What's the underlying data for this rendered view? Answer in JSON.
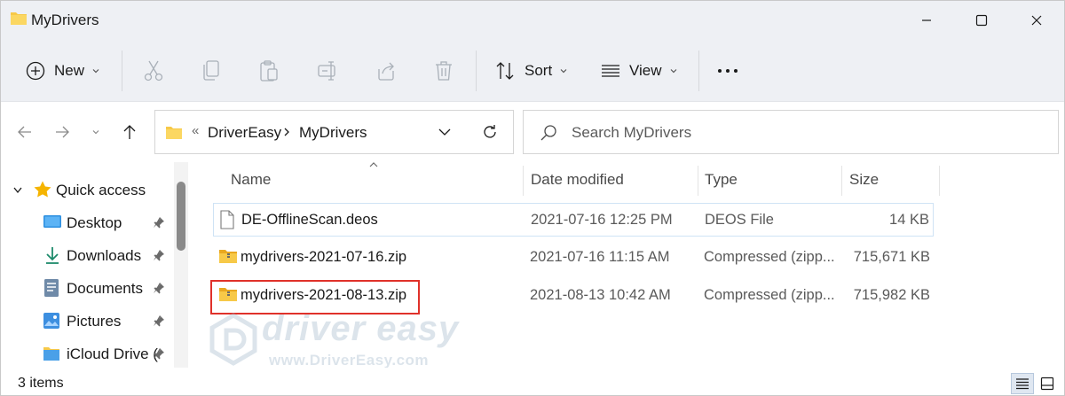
{
  "window": {
    "title": "MyDrivers",
    "controls": {
      "minimize_icon": "minimize-icon",
      "maximize_icon": "maximize-icon",
      "close_icon": "close-icon"
    }
  },
  "commandbar": {
    "new_label": "New",
    "sort_label": "Sort",
    "view_label": "View",
    "icons": [
      "cut-icon",
      "copy-icon",
      "paste-icon",
      "rename-icon",
      "share-icon",
      "delete-icon",
      "more-icon"
    ]
  },
  "addressbar": {
    "breadcrumb": [
      "DriverEasy",
      "MyDrivers"
    ],
    "overflow": "«"
  },
  "search": {
    "placeholder": "Search MyDrivers"
  },
  "navpane": {
    "items": [
      {
        "label": "Quick access",
        "icon": "star-icon"
      },
      {
        "label": "Desktop",
        "icon": "desktop-icon"
      },
      {
        "label": "Downloads",
        "icon": "download-icon"
      },
      {
        "label": "Documents",
        "icon": "documents-icon"
      },
      {
        "label": "Pictures",
        "icon": "pictures-icon"
      },
      {
        "label": "iCloud Drive (",
        "icon": "cloud-folder-icon"
      }
    ]
  },
  "columns": {
    "name": "Name",
    "date": "Date modified",
    "type": "Type",
    "size": "Size"
  },
  "files": [
    {
      "name": "DE-OfflineScan.deos",
      "date": "2021-07-16 12:25 PM",
      "type": "DEOS File",
      "size": "14 KB",
      "icon": "file-icon"
    },
    {
      "name": "mydrivers-2021-07-16.zip",
      "date": "2021-07-16 11:15 AM",
      "type": "Compressed (zipp...",
      "size": "715,671 KB",
      "icon": "zip-folder-icon"
    },
    {
      "name": "mydrivers-2021-08-13.zip",
      "date": "2021-08-13 10:42 AM",
      "type": "Compressed (zipp...",
      "size": "715,982 KB",
      "icon": "zip-folder-icon"
    }
  ],
  "watermark": {
    "brand": "driver easy",
    "url": "www.DriverEasy.com"
  },
  "status": {
    "count": "3 items"
  },
  "colors": {
    "accent": "#0067c0",
    "highlight": "#e0312a",
    "folder": "#f7c948"
  }
}
